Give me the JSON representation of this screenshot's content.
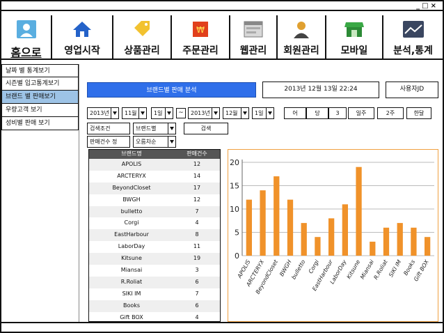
{
  "window_controls": "_□×",
  "nav": {
    "home": "홈으로",
    "items": [
      "영업시작",
      "상품관리",
      "주문관리",
      "웹관리",
      "회원관리",
      "모바일",
      "분석,통계"
    ]
  },
  "sidebar": {
    "items": [
      "날짜 별 통계보기",
      "시즌별 입고통계보기",
      "브랜드 별 판매보기",
      "우량고객 보기",
      "성비별 판매 보기"
    ],
    "active_index": 2
  },
  "header": {
    "title": "브랜드별 판매 분석",
    "datetime": "2013년 12월 13일 22:24",
    "user": "사용자JD"
  },
  "date_filter": {
    "start_year": "2013년",
    "start_month": "11월",
    "start_day": "1일",
    "separator": "~",
    "end_year": "2013년",
    "end_month": "12월",
    "end_day": "1일"
  },
  "quick_buttons": [
    "어",
    "당",
    "3",
    "일주",
    "2주",
    "한달"
  ],
  "search": {
    "condition_label": "검색조건",
    "condition_value": "브랜드별",
    "button": "검색",
    "sort_label": "판매건수 정",
    "sort_value": "오름차순"
  },
  "table": {
    "headers": [
      "브랜드명",
      "판매건수"
    ],
    "rows": [
      [
        "APOLIS",
        "12"
      ],
      [
        "ARCTERYX",
        "14"
      ],
      [
        "BeyondCloset",
        "17"
      ],
      [
        "BWGH",
        "12"
      ],
      [
        "bulletto",
        "7"
      ],
      [
        "Corgi",
        "4"
      ],
      [
        "EastHarbour",
        "8"
      ],
      [
        "LaborDay",
        "11"
      ],
      [
        "Kitsune",
        "19"
      ],
      [
        "Miansai",
        "3"
      ],
      [
        "R.Roliat",
        "6"
      ],
      [
        "SIKI IM",
        "7"
      ],
      [
        "Books",
        "6"
      ],
      [
        "Gift BOX",
        "4"
      ]
    ]
  },
  "chart_data": {
    "type": "bar",
    "categories": [
      "APOLIS",
      "ARCTERYX",
      "BeyondCloset",
      "BWGH",
      "bulletto",
      "Corgi",
      "EastHarbour",
      "LaborDay",
      "Kitsune",
      "Miansai",
      "R.Roliat",
      "SIKI IM",
      "Books",
      "Gift BOX"
    ],
    "values": [
      12,
      14,
      17,
      12,
      7,
      4,
      8,
      11,
      19,
      3,
      6,
      7,
      6,
      4
    ],
    "ylim": [
      0,
      20
    ],
    "yticks": [
      0,
      5,
      10,
      15,
      20
    ],
    "grid": true,
    "bar_color": "#f0922a"
  },
  "colors": {
    "accent": "#2f6fea",
    "sidebar_active": "#9dc3e6",
    "table_header": "#555555"
  }
}
